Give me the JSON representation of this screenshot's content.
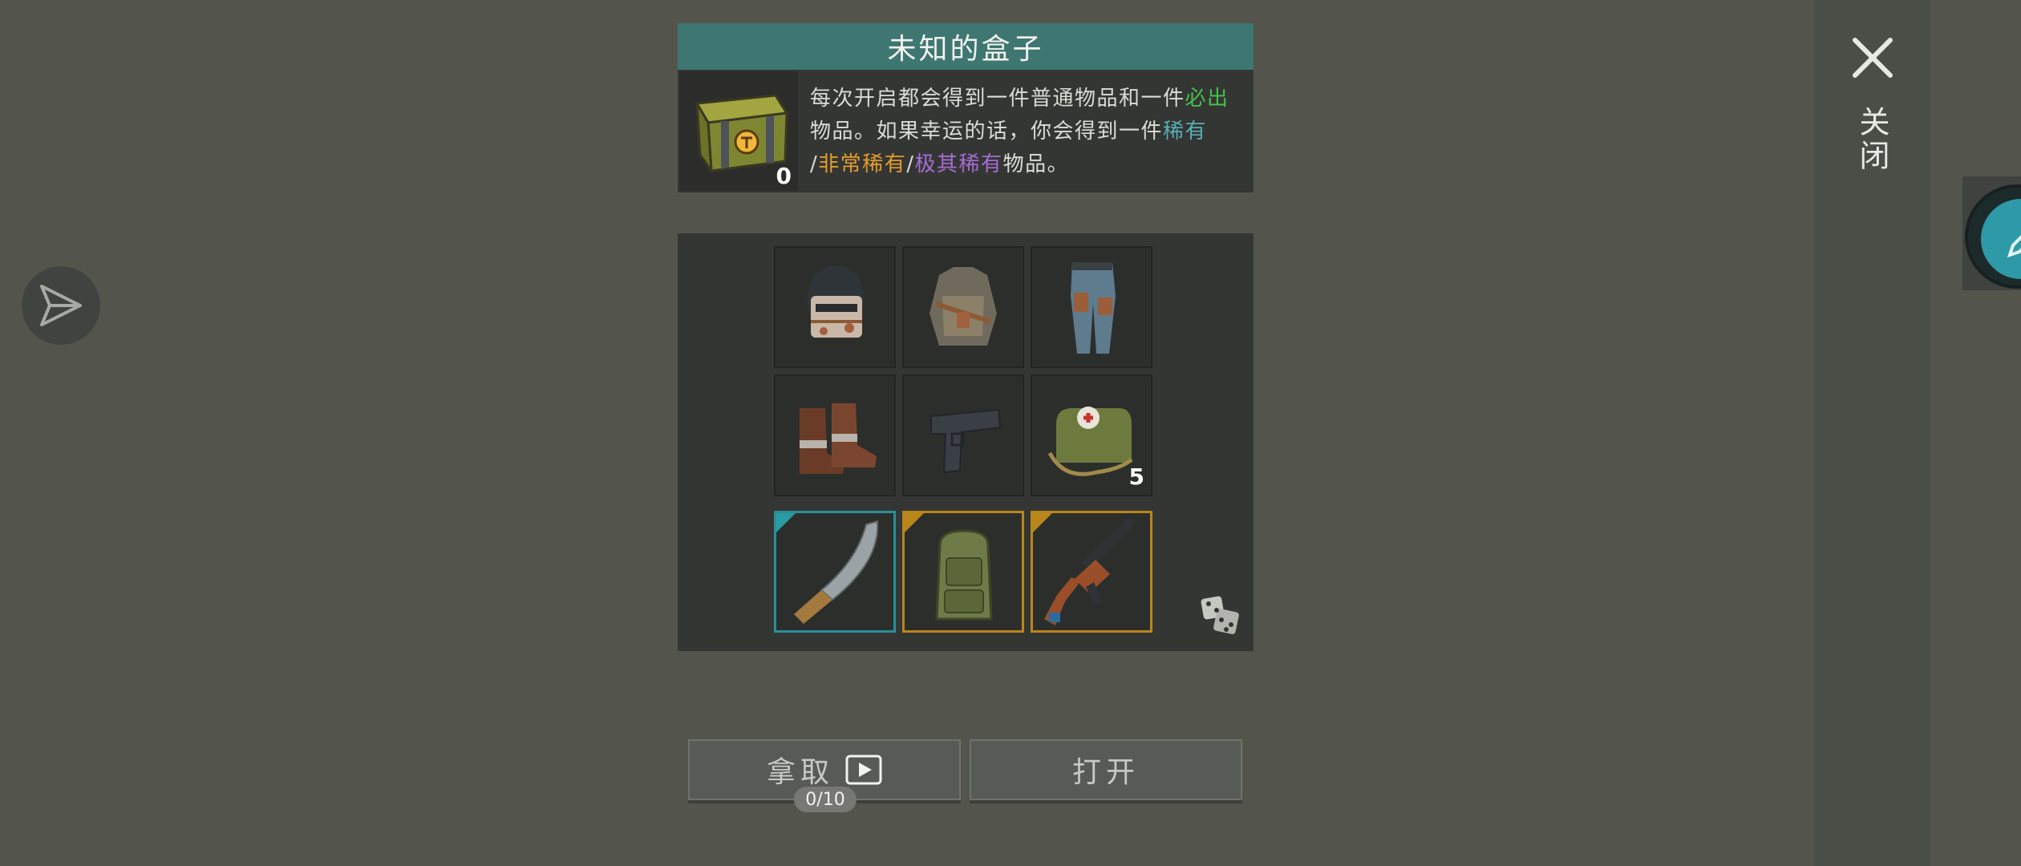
{
  "close": {
    "label": "关闭"
  },
  "box": {
    "title": "未知的盒子",
    "count": "0",
    "description": {
      "line1_a": "每次开启都会得到一件普通物品和一件",
      "line1_guaranteed": "必出",
      "line2_a": "物品。如果幸运的话，你会得到一件",
      "line2_rare": "稀有",
      "sep1": "/",
      "very_rare": "非常稀有",
      "sep2": "/",
      "extremely_rare": "极其稀有",
      "end": "物品。"
    }
  },
  "items": {
    "row1": [
      "helmet",
      "armor-jacket",
      "pants"
    ],
    "row2": [
      "boots",
      "pistol",
      "medkit-bag"
    ],
    "medkit_count": "5",
    "row3": [
      {
        "name": "machete",
        "rarity": "rare"
      },
      {
        "name": "backpack",
        "rarity": "very-rare"
      },
      {
        "name": "assault-rifle",
        "rarity": "very-rare"
      }
    ]
  },
  "buttons": {
    "take_label": "拿取",
    "open_label": "打开",
    "ad_counter": "0/10"
  },
  "colors": {
    "header": "#3e7672",
    "guaranteed": "#46c04c",
    "rare": "#56aeb4",
    "very_rare": "#e39c2c",
    "extremely_rare": "#a66bd4"
  }
}
